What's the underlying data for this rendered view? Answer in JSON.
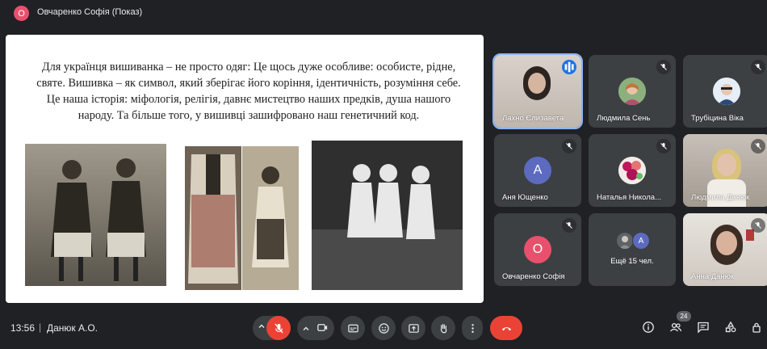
{
  "header": {
    "presenter_initial": "О",
    "presenter_title": "Овчаренко Софія (Показ)"
  },
  "slide": {
    "paragraph": "Для українця вишиванка – не просто одяг: Це щось дуже особливе: особисте, рідне, святе. Вишивка – як символ, який зберігає його коріння, ідентичність, розуміння себе. Це наша історія: міфологія, релігія, давнє мистецтво наших предків, душа нашого народу. Та більше того, у вишивці зашифровано наш генетичний код.",
    "photos": [
      "two-girls-in-folk-dress",
      "embroidered-dress",
      "woman-in-folk-dress",
      "three-girls-with-wreaths"
    ]
  },
  "participants": [
    {
      "name": "Лахно Єлизавета",
      "type": "video",
      "speaking": true
    },
    {
      "name": "Людмила Сень",
      "type": "photo",
      "muted": true
    },
    {
      "name": "Трубіцина Віка",
      "type": "photo",
      "muted": true
    },
    {
      "name": "Аня Ющенко",
      "type": "initial",
      "initial": "А",
      "color": "#5c6bc0",
      "muted": true
    },
    {
      "name": "Наталья Никола...",
      "type": "photo",
      "muted": true
    },
    {
      "name": "Людмила Данюк",
      "type": "video",
      "muted": true
    },
    {
      "name": "Овчаренко Софія",
      "type": "initial",
      "initial": "О",
      "color": "#e8506d",
      "muted": true
    },
    {
      "name": "Ещё 15 чел.",
      "type": "more",
      "initial": "А"
    },
    {
      "name": "Анна Данюк",
      "type": "video",
      "muted": true
    }
  ],
  "bottom": {
    "time": "13:56",
    "separator": "|",
    "meeting_code": "Данюк А.О.",
    "people_count": "24"
  },
  "colors": {
    "background": "#202124",
    "tile": "#3c4043",
    "red": "#ea4335",
    "accent_blue": "#1a73e8"
  }
}
